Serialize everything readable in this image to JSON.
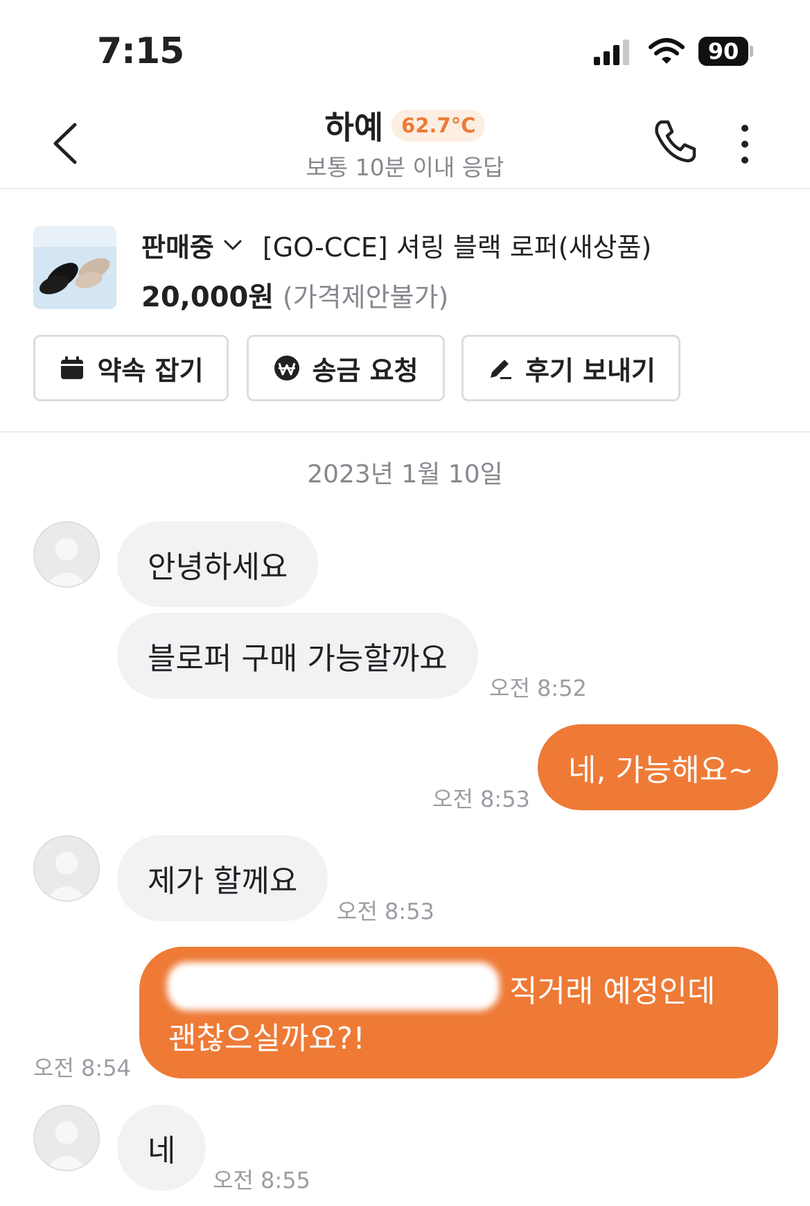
{
  "status_bar": {
    "time": "7:15",
    "battery": "90"
  },
  "header": {
    "name": "하예",
    "manner_temp": "62.7°C",
    "response_time": "보통 10분 이내 응답"
  },
  "product": {
    "status": "판매중",
    "title": "[GO-CCE] 셔링 블랙 로퍼(새상품)",
    "price": "20,000원",
    "price_note": "(가격제안불가)"
  },
  "actions": [
    {
      "label": "약속 잡기",
      "icon": "calendar-icon"
    },
    {
      "label": "송금 요청",
      "icon": "won-icon"
    },
    {
      "label": "후기 보내기",
      "icon": "pencil-icon"
    }
  ],
  "chat": {
    "date": "2023년 1월 10일",
    "messages": [
      {
        "from": "other",
        "text": "안녕하세요",
        "time": ""
      },
      {
        "from": "other",
        "text": "블로퍼 구매 가능할까요",
        "time": "오전 8:52"
      },
      {
        "from": "me",
        "text": "네, 가능해요~",
        "time": "오전 8:53"
      },
      {
        "from": "other",
        "text": "제가 할께요",
        "time": "오전 8:53"
      },
      {
        "from": "me",
        "text_line1": "직거래 예정인데",
        "text_line2": "괜찮으실까요?!",
        "time": "오전 8:54"
      },
      {
        "from": "other",
        "text": "네",
        "time": "오전 8:55"
      }
    ]
  },
  "colors": {
    "accent": "#ee7a36",
    "bubble_in": "#f1f2f4",
    "muted": "#85888e"
  }
}
